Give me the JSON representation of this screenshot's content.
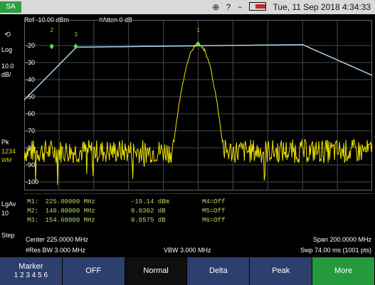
{
  "header": {
    "mode": "SA",
    "ref_level": "Ref -10.00 dBm",
    "atten": "#Atten 0 dB",
    "datetime": "Tue, 11 Sep 2018 4:34:33",
    "status_icons": [
      "gps-icon",
      "help-icon",
      "usb-icon",
      "battery-icon"
    ]
  },
  "left_panel": {
    "scale_type": "Log",
    "scale_value": "10.0",
    "scale_unit": "dB/",
    "detector": "Pk",
    "traces": "1234",
    "trace_mode": "WM",
    "avg_type": "LgAv",
    "avg_count": "10",
    "step": "Step"
  },
  "y_axis": {
    "ticks": [
      "-20",
      "-30",
      "-40",
      "-50",
      "-60",
      "-70",
      "-80",
      "-90",
      "-100"
    ]
  },
  "plot": {
    "colors": {
      "trace_main": "#f2e600",
      "trace_max": "#a8d5e8",
      "grid": "#4a4a4a",
      "marker": "#57e05d"
    },
    "markers_on_plot": [
      {
        "label": "1",
        "freq_mhz": 225.0
      },
      {
        "label": "2",
        "freq_mhz": 140.8
      },
      {
        "label": "3",
        "freq_mhz": 154.6
      }
    ]
  },
  "markers": [
    {
      "name": "M1:",
      "freq": "225.00000 MHz",
      "value": "-19.14 dBm",
      "other": "M4=Off"
    },
    {
      "name": "M2:",
      "freq": "140.80000 MHz",
      "value": "0.0302 dB",
      "other": "M5=Off"
    },
    {
      "name": "M3:",
      "freq": "154.60000 MHz",
      "value": "0.0575 dB",
      "other": "M6=Off"
    }
  ],
  "bottom": {
    "center": "Center 225.0000 MHz",
    "span": "Span 200.0000 MHz",
    "res_bw": "#Res BW 3.000 MHz",
    "vbw": "VBW 3.000 MHz",
    "sweep": "Swp 74.00 ms (1001 pts)"
  },
  "softkeys": [
    {
      "label": "Marker",
      "sub": "1 2 3 4 5 6",
      "style": "blue"
    },
    {
      "label": "OFF",
      "style": "blue"
    },
    {
      "label": "Normal",
      "style": "dark"
    },
    {
      "label": "Delta",
      "style": "blue"
    },
    {
      "label": "Peak",
      "style": "blue"
    },
    {
      "label": "More",
      "style": "green"
    }
  ]
}
